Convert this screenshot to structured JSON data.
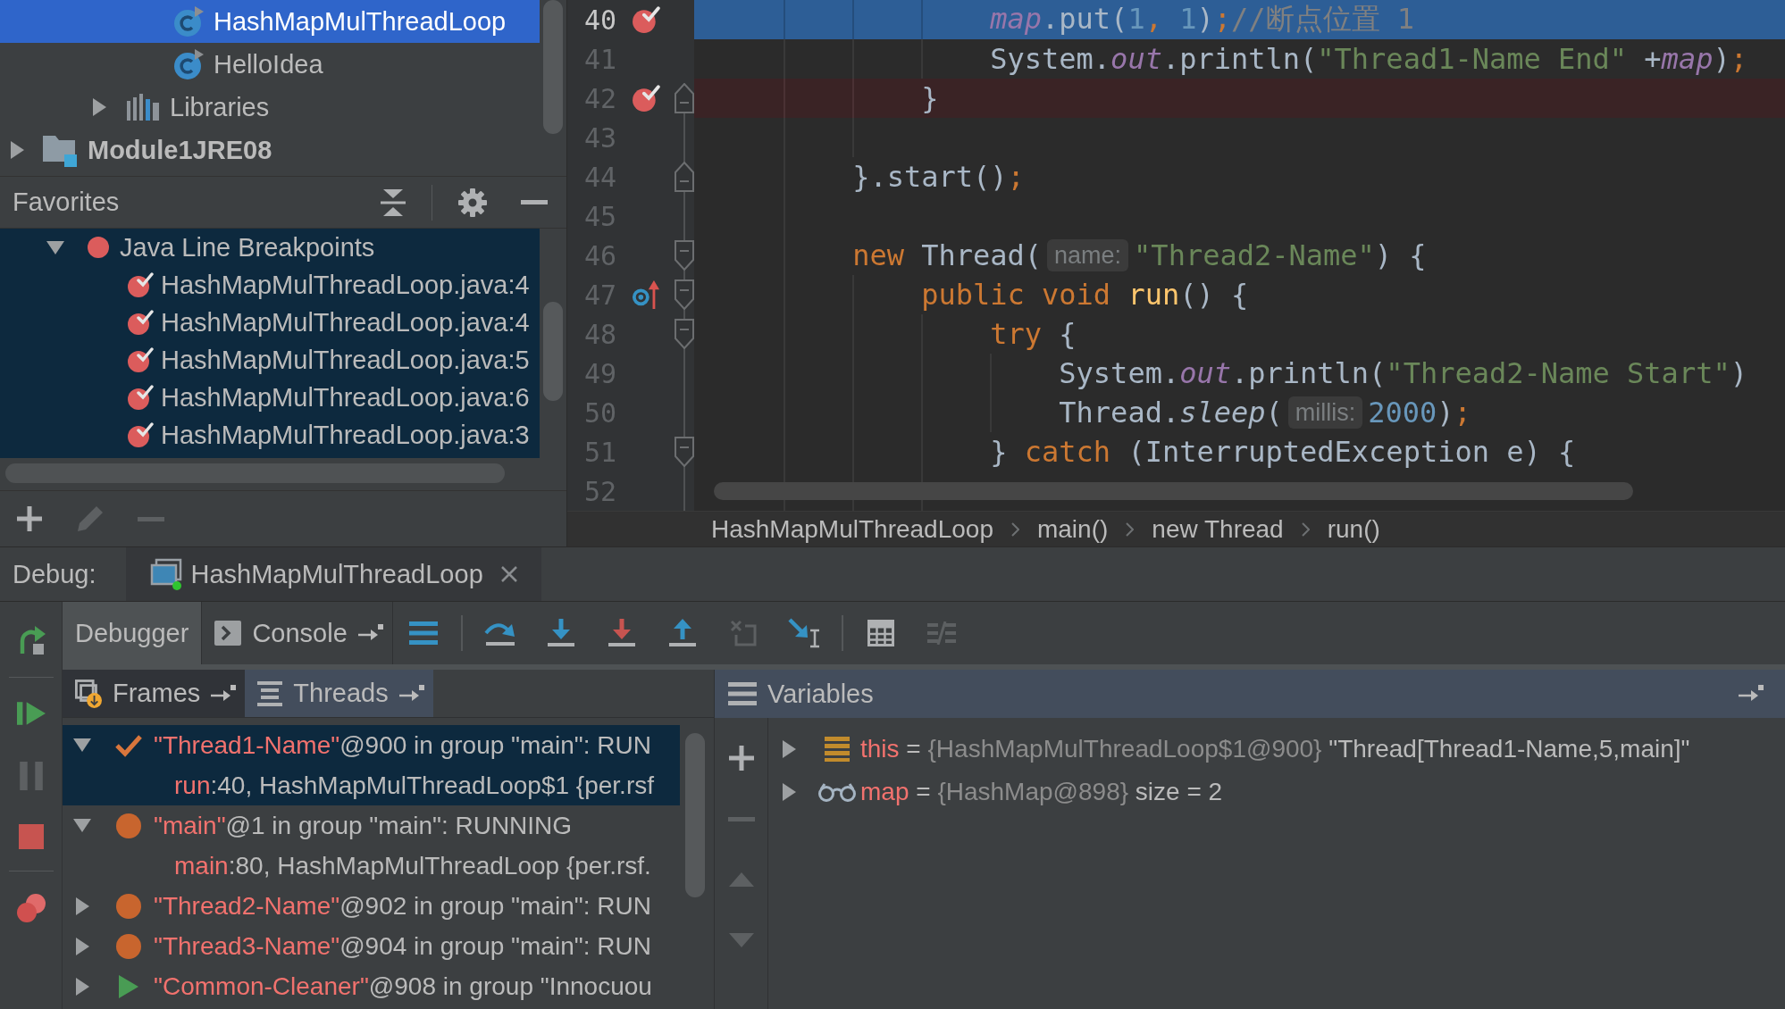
{
  "project_tree": [
    {
      "children": [
        {
          "children": [
            {
              "kind": "class",
              "label": "HashMapMulThreadLoop",
              "selected": true
            },
            {
              "kind": "class",
              "label": "HelloIdea",
              "selected": false
            }
          ]
        },
        {
          "kind": "libraries",
          "label": "Libraries",
          "expanded": false,
          "selected": false
        }
      ]
    },
    {
      "kind": "module",
      "label": "Module1JRE08",
      "expanded": false,
      "selected": false
    }
  ],
  "favorites": {
    "title": "Favorites",
    "items": [
      {
        "label": "Java Line Breakpoints",
        "expanded": true,
        "children": [
          {
            "label": "HashMapMulThreadLoop.java:4"
          },
          {
            "label": "HashMapMulThreadLoop.java:4"
          },
          {
            "label": "HashMapMulThreadLoop.java:5"
          },
          {
            "label": "HashMapMulThreadLoop.java:6"
          },
          {
            "label": "HashMapMulThreadLoop.java:3"
          }
        ]
      }
    ],
    "toolbar": [
      {
        "kind": "add",
        "disabled": false
      },
      {
        "kind": "edit",
        "disabled": true
      },
      {
        "kind": "remove",
        "disabled": true
      }
    ]
  },
  "editor": {
    "lines": [
      {
        "number": "40",
        "breakpoint": true,
        "current": true,
        "override": false,
        "fold_start": false,
        "fold_end": false,
        "tokens": [
          {
            "kind": "field",
            "text": "                map"
          },
          {
            "kind": "plain",
            "text": ".put("
          },
          {
            "kind": "number",
            "text": "1"
          },
          {
            "kind": "punct",
            "text": ", "
          },
          {
            "kind": "number",
            "text": "1"
          },
          {
            "kind": "plain",
            "text": ")"
          },
          {
            "kind": "punct",
            "text": ";"
          },
          {
            "kind": "comment",
            "text": "//断点位置 1"
          }
        ]
      },
      {
        "number": "41",
        "breakpoint": false,
        "current": false,
        "override": false,
        "fold_start": false,
        "fold_end": false,
        "tokens": [
          {
            "kind": "plain",
            "text": "                System."
          },
          {
            "kind": "field",
            "text": "out"
          },
          {
            "kind": "plain",
            "text": ".println("
          },
          {
            "kind": "string",
            "text": "\"Thread1-Name End\""
          },
          {
            "kind": "plain",
            "text": " +"
          },
          {
            "kind": "field",
            "text": "map"
          },
          {
            "kind": "plain",
            "text": ")"
          },
          {
            "kind": "punct",
            "text": ";"
          }
        ]
      },
      {
        "number": "42",
        "breakpoint": true,
        "current": false,
        "override": false,
        "fold_start": false,
        "fold_end": true,
        "tokens": [
          {
            "kind": "plain",
            "text": "            }"
          }
        ]
      },
      {
        "number": "43",
        "breakpoint": false,
        "current": false,
        "override": false,
        "fold_start": false,
        "fold_end": false
      },
      {
        "number": "44",
        "breakpoint": false,
        "current": false,
        "override": false,
        "fold_start": false,
        "fold_end": true,
        "tokens": [
          {
            "kind": "plain",
            "text": "        }.start()"
          },
          {
            "kind": "punct",
            "text": ";"
          }
        ]
      },
      {
        "number": "45",
        "breakpoint": false,
        "current": false,
        "override": false,
        "fold_start": false,
        "fold_end": false
      },
      {
        "number": "46",
        "breakpoint": false,
        "current": false,
        "override": false,
        "fold_start": true,
        "fold_end": false,
        "tokens": [
          {
            "kind": "keyword",
            "text": "        new"
          },
          {
            "kind": "plain",
            "text": " Thread("
          },
          {
            "kind": "hint",
            "text": "name:"
          },
          {
            "kind": "string",
            "text": "\"Thread2-Name\""
          },
          {
            "kind": "plain",
            "text": ") {"
          }
        ]
      },
      {
        "number": "47",
        "breakpoint": false,
        "current": false,
        "override": true,
        "fold_start": true,
        "fold_end": false,
        "tokens": [
          {
            "kind": "keyword",
            "text": "            public void "
          },
          {
            "kind": "method",
            "text": "run"
          },
          {
            "kind": "plain",
            "text": "() {"
          }
        ]
      },
      {
        "number": "48",
        "breakpoint": false,
        "current": false,
        "override": false,
        "fold_start": true,
        "fold_end": false,
        "tokens": [
          {
            "kind": "keyword",
            "text": "                try"
          },
          {
            "kind": "plain",
            "text": " {"
          }
        ]
      },
      {
        "number": "49",
        "breakpoint": false,
        "current": false,
        "override": false,
        "fold_start": false,
        "fold_end": false,
        "tokens": [
          {
            "kind": "plain",
            "text": "                    System."
          },
          {
            "kind": "field",
            "text": "out"
          },
          {
            "kind": "plain",
            "text": ".println("
          },
          {
            "kind": "string",
            "text": "\"Thread2-Name Start\""
          },
          {
            "kind": "plain",
            "text": ")"
          }
        ]
      },
      {
        "number": "50",
        "breakpoint": false,
        "current": false,
        "override": false,
        "fold_start": false,
        "fold_end": false,
        "tokens": [
          {
            "kind": "plain",
            "text": "                    Thread."
          },
          {
            "kind": "static",
            "text": "sleep"
          },
          {
            "kind": "plain",
            "text": "("
          },
          {
            "kind": "hint",
            "text": "millis:"
          },
          {
            "kind": "number",
            "text": "2000"
          },
          {
            "kind": "plain",
            "text": ")"
          },
          {
            "kind": "punct",
            "text": ";"
          }
        ]
      },
      {
        "number": "51",
        "breakpoint": false,
        "current": false,
        "override": false,
        "fold_start": true,
        "fold_end": false,
        "tokens": [
          {
            "kind": "plain",
            "text": "                } "
          },
          {
            "kind": "keyword",
            "text": "catch"
          },
          {
            "kind": "plain",
            "text": " (InterruptedException e) {"
          }
        ]
      },
      {
        "number": "52",
        "breakpoint": false,
        "current": false,
        "override": false,
        "fold_start": false,
        "fold_end": false
      }
    ],
    "breadcrumbs": [
      "HashMapMulThreadLoop",
      "main()",
      "new Thread",
      "run()"
    ]
  },
  "debug": {
    "label": "Debug:",
    "session": "HashMapMulThreadLoop",
    "side_toolbar": [
      {
        "buttons": [
          {
            "kind": "rerun",
            "disabled": false
          }
        ]
      },
      {
        "buttons": [
          {
            "kind": "resume",
            "disabled": false
          },
          {
            "kind": "pause",
            "disabled": true
          },
          {
            "kind": "stop",
            "disabled": false
          }
        ]
      },
      {
        "buttons": [
          {
            "kind": "breakpoints",
            "disabled": false
          }
        ]
      }
    ],
    "tabs": [
      {
        "kind": "plain",
        "label": "Debugger",
        "selected": true
      },
      {
        "kind": "console",
        "label": "Console",
        "selected": false
      }
    ],
    "toolbar": [
      {
        "buttons": [
          {
            "kind": "execution",
            "disabled": false
          }
        ]
      },
      {
        "buttons": [
          {
            "kind": "over",
            "disabled": false
          },
          {
            "kind": "into",
            "disabled": false
          },
          {
            "kind": "force",
            "disabled": false
          },
          {
            "kind": "out",
            "disabled": false
          },
          {
            "kind": "drop",
            "disabled": true
          },
          {
            "kind": "cursor",
            "disabled": false
          }
        ]
      },
      {
        "buttons": [
          {
            "kind": "evaluate",
            "disabled": false
          },
          {
            "kind": "trace",
            "disabled": true
          }
        ]
      }
    ],
    "panel_tabs": [
      {
        "kind": "frames",
        "label": "Frames",
        "selected": false
      },
      {
        "kind": "threads",
        "label": "Threads",
        "selected": true
      }
    ],
    "threads": [
      {
        "kind": "current",
        "name": "\"Thread1-Name\"",
        "info": "@900 in group \"main\": RUN",
        "expanded": true,
        "selected": true,
        "frames": [
          {
            "method": "run",
            "location": ":40, HashMapMulThreadLoop$1 {per.rsf",
            "selected": true
          }
        ]
      },
      {
        "kind": "suspended",
        "name": "\"main\"",
        "info": "@1 in group \"main\": RUNNING",
        "expanded": true,
        "selected": false,
        "frames": [
          {
            "method": "main",
            "location": ":80, HashMapMulThreadLoop {per.rsf.",
            "selected": false
          }
        ]
      },
      {
        "kind": "suspended",
        "name": "\"Thread2-Name\"",
        "info": "@902 in group \"main\": RUN",
        "expanded": false,
        "selected": false
      },
      {
        "kind": "suspended",
        "name": "\"Thread3-Name\"",
        "info": "@904 in group \"main\": RUN",
        "expanded": false,
        "selected": false
      },
      {
        "kind": "running",
        "name": "\"Common-Cleaner\"",
        "info": "@908 in group \"Innocuou",
        "expanded": false,
        "selected": false
      }
    ],
    "variables": {
      "title": "Variables",
      "toolbar": [
        {
          "kind": "add",
          "disabled": false
        },
        {
          "kind": "remove",
          "disabled": true
        },
        {
          "kind": "up",
          "disabled": true
        },
        {
          "kind": "down",
          "disabled": true
        }
      ],
      "rows": [
        {
          "kind": "field",
          "name": "this",
          "sign": "=",
          "type": "{HashMapMulThreadLoop$1@900}",
          "value": "\"Thread[Thread1-Name,5,main]\"",
          "expanded": false
        },
        {
          "kind": "watch",
          "name": "map",
          "sign": "=",
          "type": "{HashMap@898}",
          "value": "size = 2",
          "expanded": false
        }
      ]
    }
  }
}
